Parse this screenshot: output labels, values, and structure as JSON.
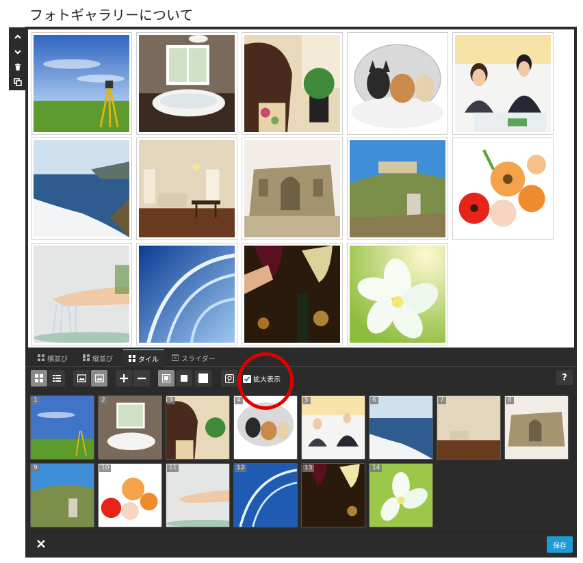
{
  "page": {
    "title": "フォトギャラリーについて"
  },
  "tabs": [
    {
      "label": "横並び"
    },
    {
      "label": "縦並び"
    },
    {
      "label": "タイル"
    },
    {
      "label": "スライダー"
    }
  ],
  "toolbar": {
    "zoom_label": "拡大表示",
    "zoom_checked": true,
    "help_label": "?"
  },
  "footer": {
    "close_label": "✕",
    "save_label": "保存"
  },
  "images": [
    {
      "num": "1",
      "subject": "survey-tripod-on-meadow"
    },
    {
      "num": "2",
      "subject": "bathtub-room"
    },
    {
      "num": "3",
      "subject": "armchair-with-plant"
    },
    {
      "num": "4",
      "subject": "three-chihuahuas"
    },
    {
      "num": "5",
      "subject": "business-meeting"
    },
    {
      "num": "6",
      "subject": "seashore-waves"
    },
    {
      "num": "7",
      "subject": "living-room"
    },
    {
      "num": "8",
      "subject": "ancient-ruins"
    },
    {
      "num": "9",
      "subject": "hilltop-ruins"
    },
    {
      "num": "10",
      "subject": "gerbera-flowers"
    },
    {
      "num": "11",
      "subject": "water-on-hands"
    },
    {
      "num": "12",
      "subject": "blue-glass-abstract"
    },
    {
      "num": "13",
      "subject": "wine-toast"
    },
    {
      "num": "14",
      "subject": "white-plumeria"
    }
  ],
  "colors": {
    "accent": "#2aa3dc",
    "save": "#1e9ad6",
    "highlight": "#e00000",
    "panel": "#2b2b2b"
  }
}
